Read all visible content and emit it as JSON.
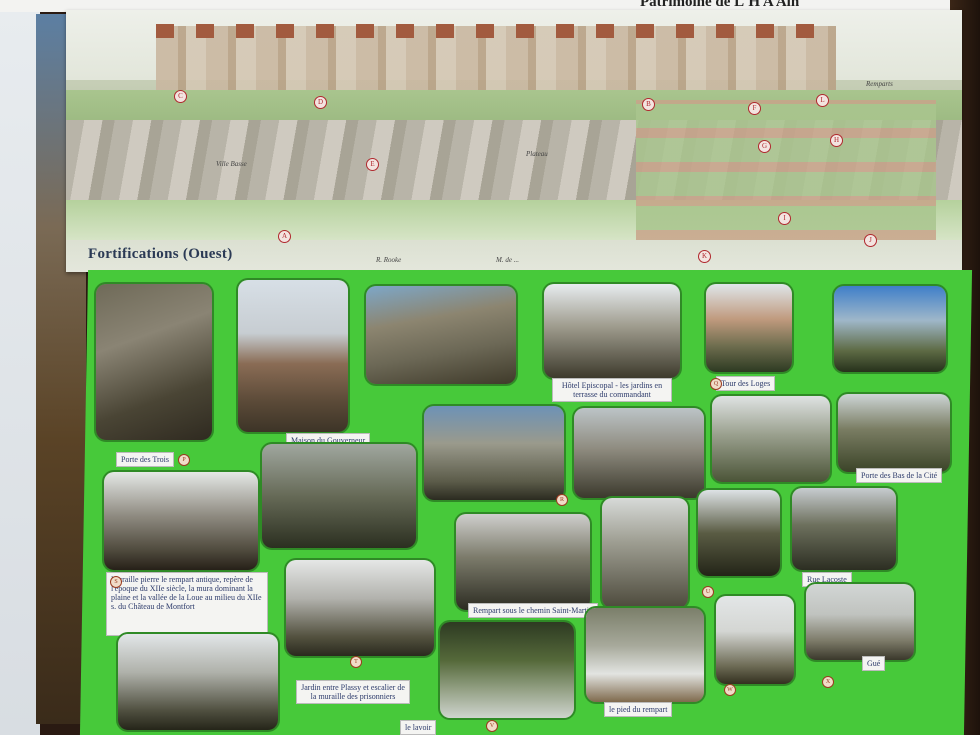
{
  "header": {
    "corner_text": "Patrimoine de L'H A Ain"
  },
  "poster": {
    "title": "Fortifications (Ouest)",
    "markers": [
      "C",
      "D",
      "E",
      "A",
      "B",
      "F",
      "G",
      "H",
      "I",
      "J",
      "K",
      "L"
    ],
    "credit_left": "R. Rooke",
    "credit_right": "M. de ...",
    "area_labels": [
      "Ville Basse",
      "Plateau",
      "Remparts"
    ]
  },
  "board": {
    "captions": {
      "poterne": "Porte des Trois",
      "maison": "Maison du Gouverneur",
      "hotel": "Hôtel Episcopal - les jardins en terrasse du commandant",
      "tour_loges": "Tour des Loges",
      "porte_bas": "Porte des Bas de la Cité",
      "note": "Muraille pierre le rempart antique, repère de l'époque du XIIe siècle, la mura dominant la plaine et la vallée de la Loue au milieu du XIIe s. du Château de Montfort",
      "rempart": "Rempart sous le chemin Saint-Martin",
      "jardin": "Jardin entre Plassy et escalier de la muraille des prisonniers",
      "bottom_cap": "le pied du rempart",
      "small1": "Rue Lacoste",
      "small2": "Gué",
      "small3": "le lavoir"
    },
    "badges": [
      "P",
      "Q",
      "R",
      "S",
      "T",
      "U",
      "V",
      "W",
      "X",
      "Y",
      "Z"
    ]
  }
}
